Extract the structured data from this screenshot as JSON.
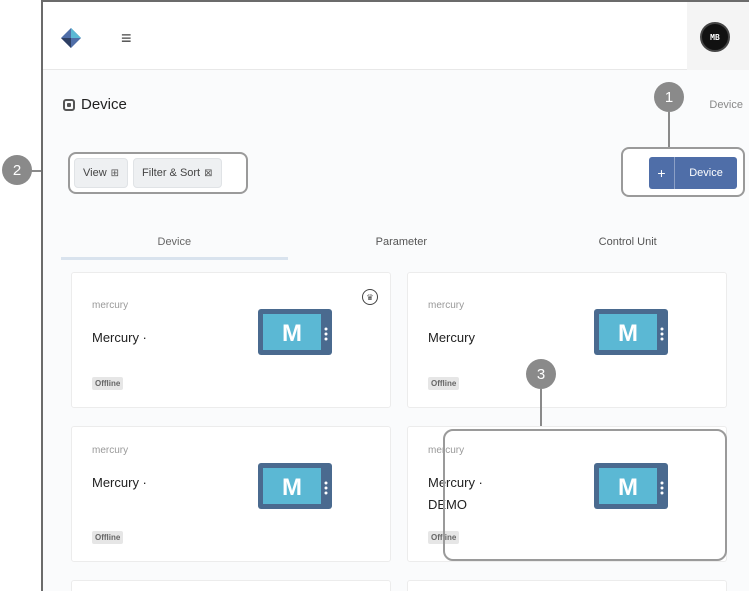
{
  "header": {
    "logo_icon": "diamond-logo-icon",
    "menu_icon": "≡",
    "avatar_text": "MB"
  },
  "page": {
    "title": "Device",
    "breadcrumb": "Device"
  },
  "toolbar": {
    "view_label": "View",
    "view_icon": "⊞",
    "filter_label": "Filter & Sort",
    "filter_icon": "⊠",
    "add_plus": "+",
    "add_label": "Device"
  },
  "tabs": [
    {
      "label": "Device"
    },
    {
      "label": "Parameter"
    },
    {
      "label": "Control Unit"
    }
  ],
  "cards": [
    {
      "brand": "mercury",
      "name": "Mercury ·",
      "name2": "",
      "status": "Offline",
      "crown": "♛",
      "device_letter": "M"
    },
    {
      "brand": "mercury",
      "name": "Mercury",
      "name2": "",
      "status": "Offline",
      "device_letter": "M"
    },
    {
      "brand": "mercury",
      "name": "Mercury ·",
      "name2": "",
      "status": "Offline",
      "device_letter": "M"
    },
    {
      "brand": "mercury",
      "name": "Mercury ·",
      "name2": "DEMO",
      "status": "Offline",
      "device_letter": "M"
    }
  ],
  "callouts": {
    "one": "1",
    "two": "2",
    "three": "3"
  },
  "colors": {
    "primary": "#4f6ea8",
    "device_screen": "#5bb8d4",
    "callout": "#8a8a8a"
  }
}
